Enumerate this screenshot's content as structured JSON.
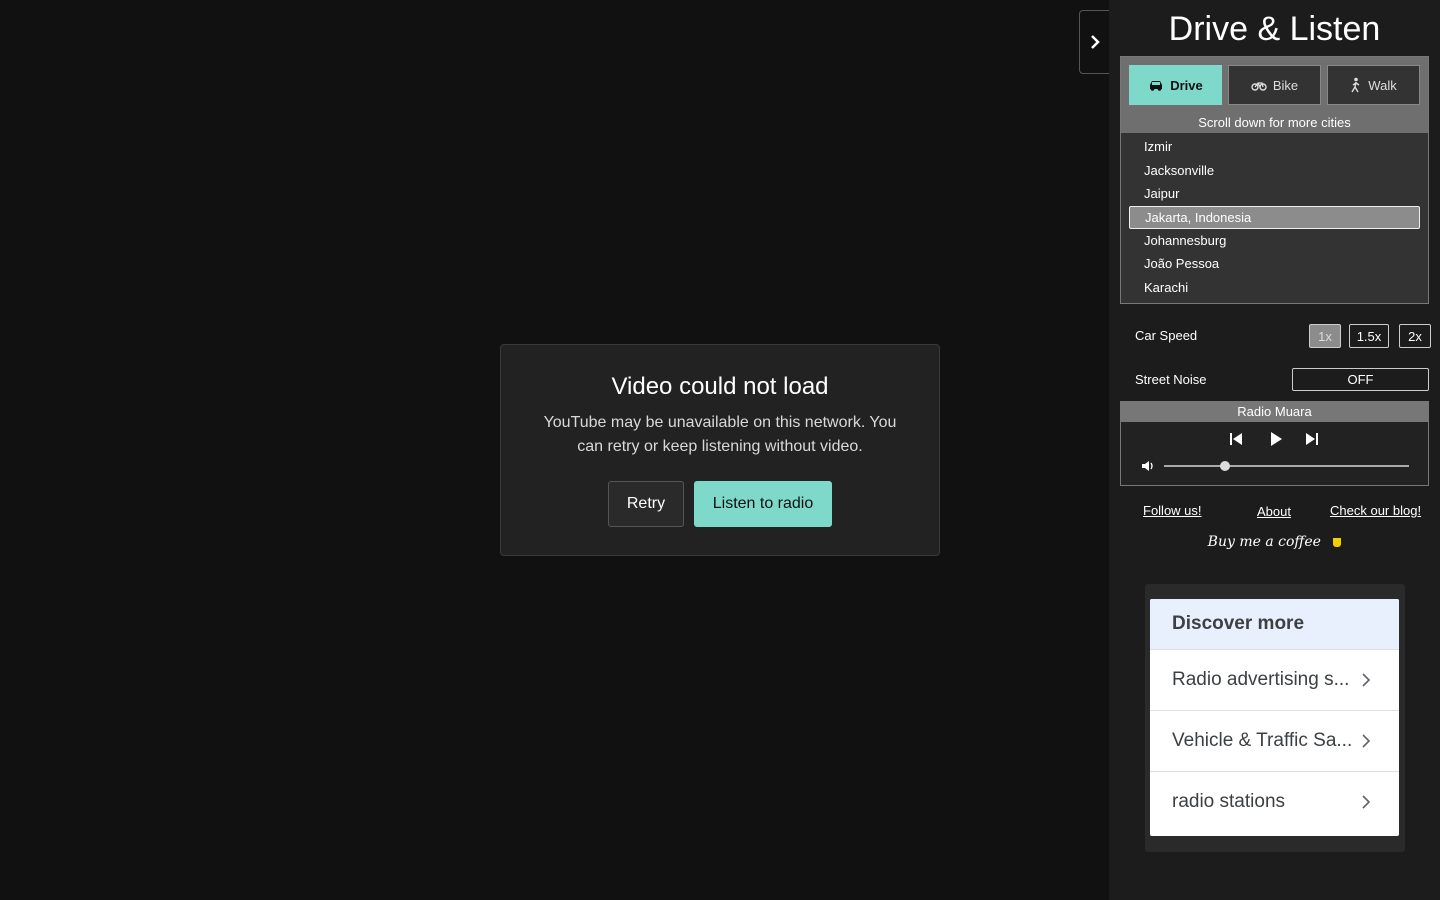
{
  "dialog": {
    "title": "Video could not load",
    "message": "YouTube may be unavailable on this network. You can retry or keep listening without video.",
    "retry_label": "Retry",
    "radio_label": "Listen to radio"
  },
  "sidebar": {
    "title": "Drive & Listen",
    "modes": [
      {
        "label": "Drive",
        "icon": "car-icon",
        "active": true
      },
      {
        "label": "Bike",
        "icon": "bike-icon",
        "active": false
      },
      {
        "label": "Walk",
        "icon": "walk-icon",
        "active": false
      }
    ],
    "scroll_hint": "Scroll down for more cities",
    "cities": [
      "Izmir",
      "Jacksonville",
      "Jaipur",
      "Jakarta, Indonesia",
      "Johannesburg",
      "João Pessoa",
      "Karachi"
    ],
    "selected_city": "Jakarta, Indonesia",
    "car_speed_label": "Car Speed",
    "speeds": [
      "1x",
      "1.5x",
      "2x"
    ],
    "selected_speed": "1x",
    "street_noise_label": "Street Noise",
    "street_noise_value": "OFF",
    "player": {
      "station": "Radio Muara",
      "volume": 0.25
    },
    "links": {
      "follow": "Follow us!",
      "about": "About",
      "blog": "Check our blog!"
    },
    "coffee": "Buy me a coffee"
  },
  "ad": {
    "heading": "Discover more",
    "items": [
      "Radio advertising s...",
      "Vehicle & Traffic Sa...",
      "radio stations"
    ]
  },
  "colors": {
    "accent": "#7fd9cb",
    "background": "#111111",
    "sidebar": "#1c1c1c"
  }
}
